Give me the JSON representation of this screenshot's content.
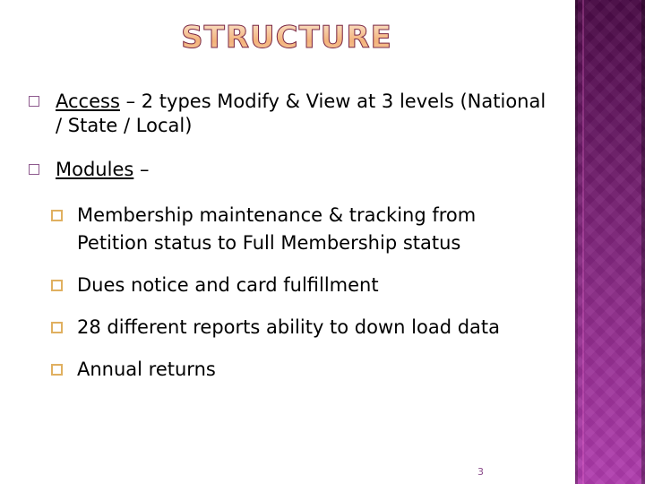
{
  "slide": {
    "title": "STRUCTURE",
    "page_number": "3",
    "colors": {
      "title_fill": "#f3b27a",
      "title_outline": "#7a2a4a",
      "side_panel_top": "#4a0a46",
      "side_panel_bottom": "#b03cae",
      "level1_bullet": "#8e5a8e",
      "level2_bullet": "#e0b060"
    },
    "bullets": [
      {
        "term": "Access",
        "text": " – 2 types Modify & View at 3 levels (National / State / Local)"
      },
      {
        "term": "Modules",
        "text": " –",
        "sub": [
          {
            "text": "Membership maintenance & tracking from Petition status to Full Membership status"
          },
          {
            "text": "Dues notice and card fulfillment"
          },
          {
            "text": "28 different reports ability to down load data"
          },
          {
            "text": "Annual returns"
          }
        ]
      }
    ]
  }
}
